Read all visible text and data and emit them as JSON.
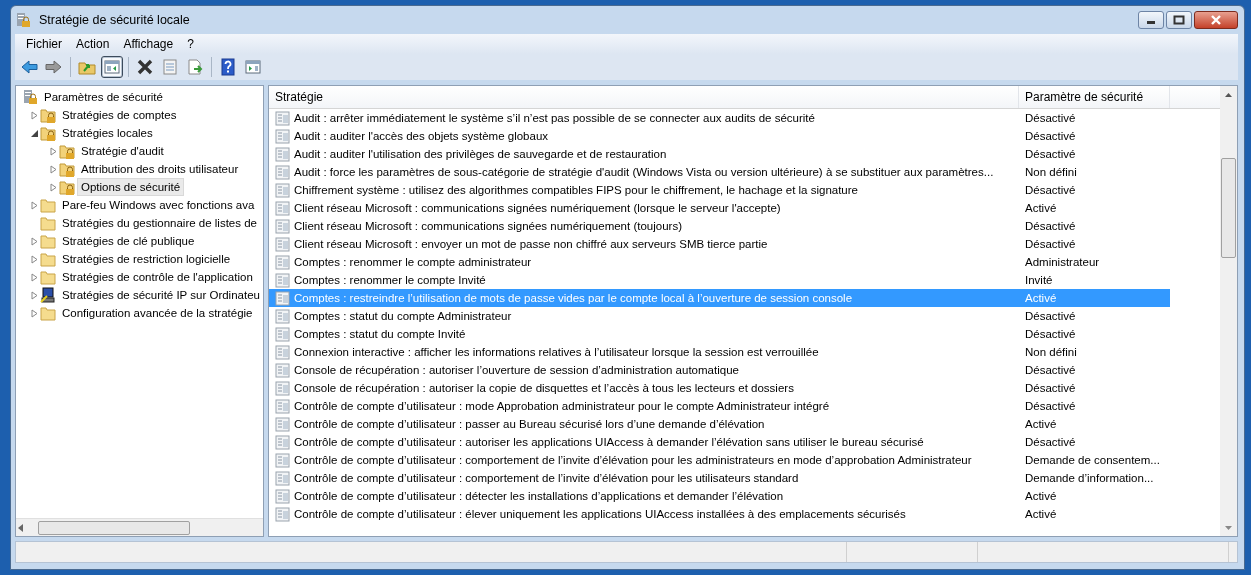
{
  "window": {
    "title": "Stratégie de sécurité locale"
  },
  "menu": [
    "Fichier",
    "Action",
    "Affichage",
    "?"
  ],
  "toolbar": [
    {
      "kind": "back",
      "pressed": false
    },
    {
      "kind": "forward",
      "pressed": false
    },
    {
      "kind": "separator"
    },
    {
      "kind": "up",
      "pressed": false
    },
    {
      "kind": "tree",
      "pressed": true
    },
    {
      "kind": "separator"
    },
    {
      "kind": "delete",
      "pressed": false
    },
    {
      "kind": "properties",
      "pressed": false
    },
    {
      "kind": "export",
      "pressed": false
    },
    {
      "kind": "separator"
    },
    {
      "kind": "help",
      "pressed": false
    },
    {
      "kind": "pane",
      "pressed": false
    }
  ],
  "tree": {
    "label": "Paramètres de sécurité",
    "kind": "root",
    "children": [
      {
        "label": "Stratégies de comptes",
        "kind": "locked-folder",
        "expanded": false,
        "selected": false
      },
      {
        "label": "Stratégies locales",
        "kind": "locked-folder",
        "expanded": true,
        "selected": false,
        "children": [
          {
            "label": "Stratégie d'audit",
            "kind": "locked-folder",
            "expanded": false,
            "selected": false
          },
          {
            "label": "Attribution des droits utilisateur",
            "kind": "locked-folder",
            "expanded": false,
            "selected": false
          },
          {
            "label": "Options de sécurité",
            "kind": "locked-folder",
            "expanded": false,
            "selected": true
          }
        ]
      },
      {
        "label": "Pare-feu Windows avec fonctions ava",
        "kind": "folder",
        "expanded": false,
        "selected": false
      },
      {
        "label": "Stratégies du gestionnaire de listes de",
        "kind": "leaf-folder",
        "selected": false
      },
      {
        "label": "Stratégies de clé publique",
        "kind": "folder",
        "expanded": false,
        "selected": false
      },
      {
        "label": "Stratégies de restriction logicielle",
        "kind": "folder",
        "expanded": false,
        "selected": false
      },
      {
        "label": "Stratégies de contrôle de l'application",
        "kind": "folder",
        "expanded": false,
        "selected": false
      },
      {
        "label": "Stratégies de sécurité IP sur Ordinateu",
        "kind": "computer",
        "expanded": false,
        "selected": false
      },
      {
        "label": "Configuration avancée de la stratégie",
        "kind": "folder",
        "expanded": false,
        "selected": false
      }
    ]
  },
  "table": {
    "columns": [
      "Stratégie",
      "Paramètre de sécurité"
    ],
    "rows": [
      {
        "policy": "Audit : arrêter immédiatement le système s’il n’est pas possible de se connecter aux audits de sécurité",
        "setting": "Désactivé",
        "selected": false
      },
      {
        "policy": "Audit : auditer l'accès des objets système globaux",
        "setting": "Désactivé",
        "selected": false
      },
      {
        "policy": "Audit : auditer l'utilisation des privilèges de sauvegarde et de restauration",
        "setting": "Désactivé",
        "selected": false
      },
      {
        "policy": "Audit : force les paramètres de sous-catégorie de stratégie d'audit (Windows Vista ou version ultérieure) à se substituer aux paramètres...",
        "setting": "Non défini",
        "selected": false
      },
      {
        "policy": "Chiffrement système : utilisez des algorithmes compatibles FIPS pour le chiffrement, le hachage et la signature",
        "setting": "Désactivé",
        "selected": false
      },
      {
        "policy": "Client réseau Microsoft : communications signées numériquement (lorsque le serveur l'accepte)",
        "setting": "Activé",
        "selected": false
      },
      {
        "policy": "Client réseau Microsoft : communications signées numériquement (toujours)",
        "setting": "Désactivé",
        "selected": false
      },
      {
        "policy": "Client réseau Microsoft : envoyer un mot de passe non chiffré aux serveurs SMB tierce partie",
        "setting": "Désactivé",
        "selected": false
      },
      {
        "policy": "Comptes : renommer le compte administrateur",
        "setting": "Administrateur",
        "selected": false
      },
      {
        "policy": "Comptes : renommer le compte Invité",
        "setting": "Invité",
        "selected": false
      },
      {
        "policy": "Comptes : restreindre l’utilisation de mots de passe vides par le compte local à l’ouverture de session console",
        "setting": "Activé",
        "selected": true
      },
      {
        "policy": "Comptes : statut du compte Administrateur",
        "setting": "Désactivé",
        "selected": false
      },
      {
        "policy": "Comptes : statut du compte Invité",
        "setting": "Désactivé",
        "selected": false
      },
      {
        "policy": "Connexion interactive : afficher les informations relatives à l’utilisateur lorsque la session est verrouillée",
        "setting": "Non défini",
        "selected": false
      },
      {
        "policy": "Console de récupération : autoriser l’ouverture de session d’administration automatique",
        "setting": "Désactivé",
        "selected": false
      },
      {
        "policy": "Console de récupération : autoriser la copie de disquettes et l’accès à tous les lecteurs et dossiers",
        "setting": "Désactivé",
        "selected": false
      },
      {
        "policy": "Contrôle de compte d’utilisateur : mode Approbation administrateur pour le compte Administrateur intégré",
        "setting": "Désactivé",
        "selected": false
      },
      {
        "policy": "Contrôle de compte d’utilisateur : passer au Bureau sécurisé lors d’une demande d’élévation",
        "setting": "Activé",
        "selected": false
      },
      {
        "policy": "Contrôle de compte d’utilisateur : autoriser les applications UIAccess à demander l’élévation sans utiliser le bureau sécurisé",
        "setting": "Désactivé",
        "selected": false
      },
      {
        "policy": "Contrôle de compte d’utilisateur : comportement de l’invite d’élévation pour les administrateurs en mode d’approbation Administrateur",
        "setting": "Demande de consentem...",
        "selected": false
      },
      {
        "policy": "Contrôle de compte d’utilisateur : comportement de l’invite d’élévation pour les utilisateurs standard",
        "setting": "Demande d’information...",
        "selected": false
      },
      {
        "policy": "Contrôle de compte d’utilisateur : détecter les installations d’applications et demander l’élévation",
        "setting": "Activé",
        "selected": false
      },
      {
        "policy": "Contrôle de compte d’utilisateur : élever uniquement les applications UIAccess installées à des emplacements sécurisés",
        "setting": "Activé",
        "selected": false
      }
    ]
  }
}
